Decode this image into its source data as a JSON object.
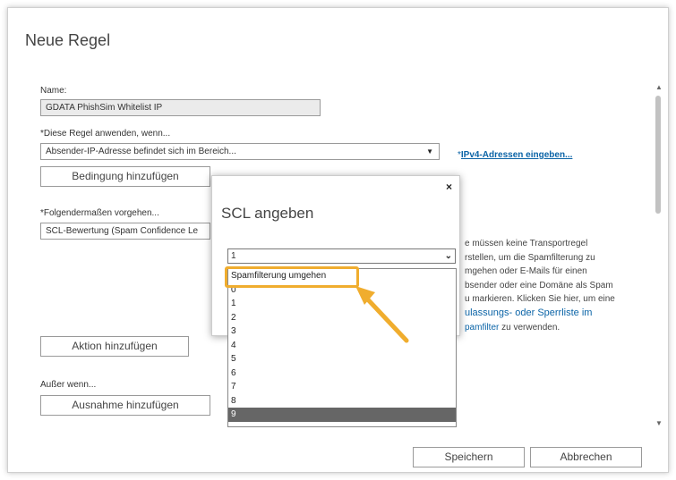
{
  "title": "Neue Regel",
  "name_label": "Name:",
  "name_value": "GDATA PhishSim Whitelist IP",
  "apply_label": "*Diese Regel anwenden, wenn...",
  "condition_value": "Absender-IP-Adresse befindet sich im Bereich...",
  "ipv4_prefix": "*",
  "ipv4_link": "IPv4-Adressen eingeben...",
  "add_condition_btn": "Bedingung hinzufügen",
  "action_label": "*Folgendermaßen vorgehen...",
  "action_value": "SCL-Bewertung (Spam Confidence Le",
  "add_action_btn": "Aktion hinzufügen",
  "except_label": "Außer wenn...",
  "add_exception_btn": "Ausnahme hinzufügen",
  "save_btn": "Speichern",
  "cancel_btn": "Abbrechen",
  "description": {
    "lines": [
      "e müssen keine Transportregel",
      "rstellen, um die Spamfilterung zu",
      "mgehen oder E-Mails für einen",
      "bsender oder eine Domäne als Spam",
      "u markieren. Klicken Sie hier, um eine"
    ],
    "link1": "ulassungs- oder Sperrliste im",
    "link2": "pamfilter",
    "tail": " zu verwenden."
  },
  "scl_dialog": {
    "title": "SCL angeben",
    "close": "×",
    "selected_value": "1",
    "options": [
      "Spamfilterung umgehen",
      "0",
      "1",
      "2",
      "3",
      "4",
      "5",
      "6",
      "7",
      "8",
      "9"
    ],
    "highlighted_option": "9",
    "callout_option": "Spamfilterung umgehen"
  },
  "colors": {
    "accent_link": "#0b64a7",
    "callout": "#f0ad2e",
    "selected_row": "#666666"
  }
}
